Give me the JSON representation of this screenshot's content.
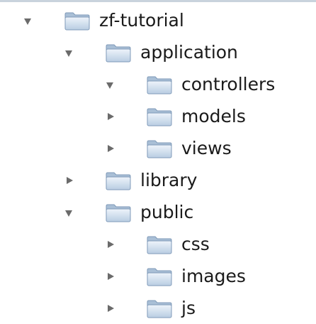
{
  "tree": {
    "items": [
      {
        "label": "zf-tutorial",
        "expanded": true,
        "icon": "folder-icon"
      },
      {
        "label": "application",
        "expanded": true,
        "icon": "folder-icon"
      },
      {
        "label": "controllers",
        "expanded": true,
        "icon": "folder-icon"
      },
      {
        "label": "models",
        "expanded": false,
        "icon": "folder-icon"
      },
      {
        "label": "views",
        "expanded": false,
        "icon": "folder-icon"
      },
      {
        "label": "library",
        "expanded": false,
        "icon": "folder-icon"
      },
      {
        "label": "public",
        "expanded": true,
        "icon": "folder-icon"
      },
      {
        "label": "css",
        "expanded": false,
        "icon": "folder-icon"
      },
      {
        "label": "images",
        "expanded": false,
        "icon": "folder-icon"
      },
      {
        "label": "js",
        "expanded": false,
        "icon": "folder-icon"
      }
    ]
  },
  "colors": {
    "folder_light": "#e4eefa",
    "folder_dark": "#a9bfd6",
    "folder_edge": "#7f9ab8",
    "disclosure": "#6b6b6b",
    "text": "#1a1a1a"
  }
}
